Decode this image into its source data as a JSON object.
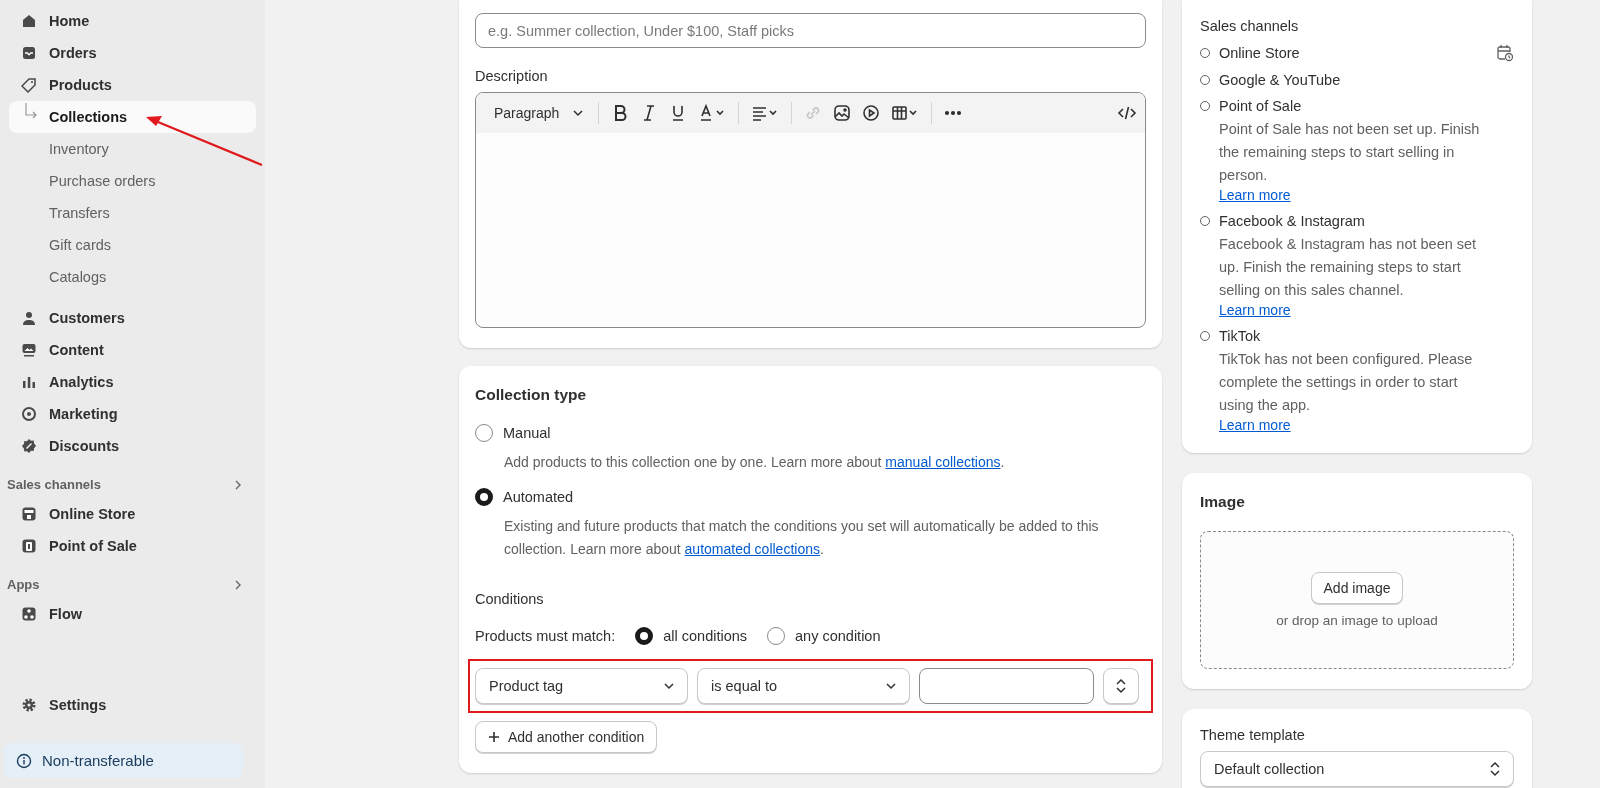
{
  "sidebar": {
    "groups": [
      {
        "items": [
          {
            "label": "Home",
            "selected": false
          },
          {
            "label": "Orders",
            "selected": false
          },
          {
            "label": "Products",
            "selected": false,
            "children": [
              {
                "label": "Collections",
                "selected": true
              },
              {
                "label": "Inventory",
                "selected": false
              },
              {
                "label": "Purchase orders",
                "selected": false
              },
              {
                "label": "Transfers",
                "selected": false
              },
              {
                "label": "Gift cards",
                "selected": false
              },
              {
                "label": "Catalogs",
                "selected": false
              }
            ]
          }
        ]
      },
      {
        "items": [
          {
            "label": "Customers",
            "selected": false
          },
          {
            "label": "Content",
            "selected": false
          },
          {
            "label": "Analytics",
            "selected": false
          },
          {
            "label": "Marketing",
            "selected": false
          },
          {
            "label": "Discounts",
            "selected": false
          }
        ]
      },
      {
        "heading": "Sales channels",
        "items": [
          {
            "label": "Online Store",
            "selected": false
          },
          {
            "label": "Point of Sale",
            "selected": false
          }
        ]
      },
      {
        "heading": "Apps",
        "items": [
          {
            "label": "Flow",
            "selected": false
          }
        ]
      }
    ],
    "settings": "Settings",
    "badge": "Non-transferable"
  },
  "title_field": {
    "placeholder": "e.g. Summer collection, Under $100, Staff picks"
  },
  "description": {
    "label": "Description",
    "style_select": "Paragraph",
    "toolbar": [
      {
        "kind": "bold",
        "disabled": false
      },
      {
        "kind": "italic",
        "disabled": false
      },
      {
        "kind": "underline",
        "disabled": false
      },
      {
        "kind": "color",
        "disabled": false
      },
      {
        "kind": "sep"
      },
      {
        "kind": "align",
        "disabled": false
      },
      {
        "kind": "sep"
      },
      {
        "kind": "link",
        "disabled": true
      },
      {
        "kind": "image",
        "disabled": false
      },
      {
        "kind": "video",
        "disabled": false
      },
      {
        "kind": "table",
        "disabled": false
      },
      {
        "kind": "sep"
      },
      {
        "kind": "more",
        "disabled": false
      },
      {
        "kind": "code",
        "disabled": false
      }
    ]
  },
  "collection_type": {
    "heading": "Collection type",
    "options": [
      {
        "label": "Manual",
        "selected": false,
        "text": "Add products to this collection one by one. Learn more about",
        "link": "manual collections",
        "after": "."
      },
      {
        "label": "Automated",
        "selected": true,
        "text": "Existing and future products that match the conditions you set will automatically be added to this collection. Learn more about",
        "link": "automated collections",
        "after": "."
      }
    ],
    "conditions": {
      "heading": "Conditions",
      "match_label": "Products must match:",
      "match_options": [
        {
          "label": "all conditions",
          "selected": true
        },
        {
          "label": "any condition",
          "selected": false
        }
      ],
      "rows": [
        {
          "field": "Product tag",
          "operator": "is equal to"
        }
      ],
      "add_button": "Add another condition"
    }
  },
  "publishing": {
    "heading": "Sales channels",
    "channels": [
      {
        "name": "Online Store",
        "scheduled": true
      },
      {
        "name": "Google & YouTube",
        "scheduled": false
      },
      {
        "name": "Point of Sale",
        "scheduled": false,
        "note": "Point of Sale has not been set up. Finish the remaining steps to start selling in person.",
        "link": "Learn more"
      },
      {
        "name": "Facebook & Instagram",
        "scheduled": false,
        "note": "Facebook & Instagram has not been set up. Finish the remaining steps to start selling on this sales channel.",
        "link": "Learn more"
      },
      {
        "name": "TikTok",
        "scheduled": false,
        "note": "TikTok has not been configured. Please complete the settings in order to start using the app.",
        "link": "Learn more"
      }
    ]
  },
  "image": {
    "heading": "Image",
    "button": "Add image",
    "hint": "or drop an image to upload"
  },
  "theme_template": {
    "label": "Theme template",
    "value": "Default collection"
  },
  "annotations": {
    "arrow": true,
    "frame": true
  }
}
